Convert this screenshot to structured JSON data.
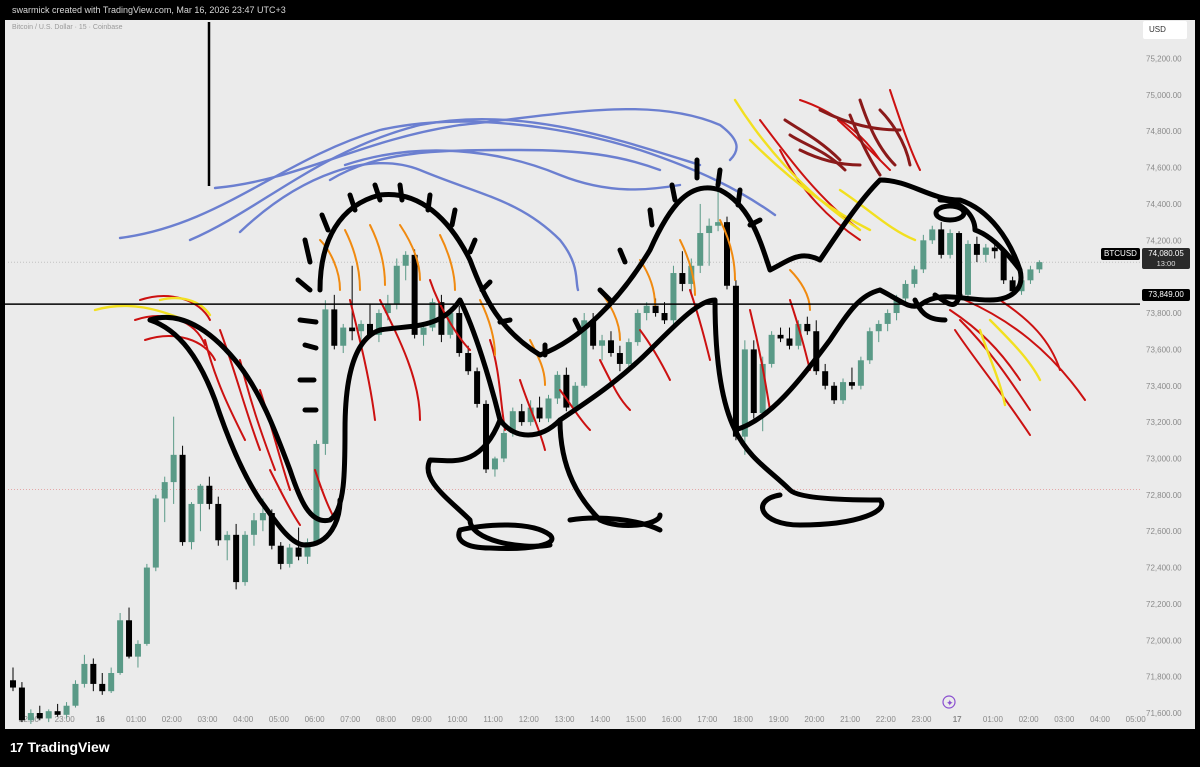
{
  "header": {
    "attribution": "swarmick created with TradingView.com, Mar 16, 2026 23:47 UTC+3"
  },
  "symbol": {
    "description": "Bitcoin / U.S. Dollar · 15 · Coinbase",
    "currency_button": "USD"
  },
  "price_labels": {
    "last_ticker": "BTCUSD",
    "last_price": "74,080.05",
    "countdown": "13:00",
    "horizontal_line_price": "73,849.00"
  },
  "branding": {
    "logo_mark": "17",
    "logo_text": "TradingView"
  },
  "colors": {
    "background": "#ebebeb",
    "up_candle": "#5a9a87",
    "down_candle": "#000000",
    "drawing_black": "#000000",
    "drawing_blue": "#6b7fd0",
    "drawing_red": "#cc1111",
    "drawing_darkred": "#8a1a1a",
    "drawing_orange": "#f08a10",
    "drawing_yellow": "#f2e020",
    "countdown_bg": "#2a2a2a"
  },
  "chart_data": {
    "type": "candlestick",
    "title": "Bitcoin / U.S. Dollar · 15 · Coinbase",
    "y_axis": {
      "ticks": [
        "75,200.00",
        "75,000.00",
        "74,800.00",
        "74,600.00",
        "74,400.00",
        "74,200.00",
        "73,800.00",
        "73,600.00",
        "73,400.00",
        "73,200.00",
        "73,000.00",
        "72,800.00",
        "72,600.00",
        "72,400.00",
        "72,200.00",
        "72,000.00",
        "71,800.00",
        "71,600.00"
      ],
      "range": [
        71500,
        75300
      ]
    },
    "x_axis": {
      "ticks": [
        "22:00",
        "23:00",
        "16",
        "01:00",
        "02:00",
        "03:00",
        "04:00",
        "05:00",
        "06:00",
        "07:00",
        "08:00",
        "09:00",
        "10:00",
        "11:00",
        "12:00",
        "13:00",
        "14:00",
        "15:00",
        "16:00",
        "17:00",
        "18:00",
        "19:00",
        "20:00",
        "21:00",
        "22:00",
        "23:00",
        "17",
        "01:00",
        "02:00",
        "03:00",
        "04:00",
        "05:00"
      ]
    },
    "candles": [
      {
        "o": 71780,
        "h": 71850,
        "l": 71720,
        "c": 71740
      },
      {
        "o": 71740,
        "h": 71770,
        "l": 71550,
        "c": 71560
      },
      {
        "o": 71560,
        "h": 71620,
        "l": 71540,
        "c": 71600
      },
      {
        "o": 71600,
        "h": 71640,
        "l": 71560,
        "c": 71570
      },
      {
        "o": 71570,
        "h": 71620,
        "l": 71550,
        "c": 71610
      },
      {
        "o": 71610,
        "h": 71650,
        "l": 71580,
        "c": 71590
      },
      {
        "o": 71590,
        "h": 71660,
        "l": 71570,
        "c": 71640
      },
      {
        "o": 71640,
        "h": 71780,
        "l": 71630,
        "c": 71760
      },
      {
        "o": 71760,
        "h": 71920,
        "l": 71740,
        "c": 71870
      },
      {
        "o": 71870,
        "h": 71900,
        "l": 71720,
        "c": 71760
      },
      {
        "o": 71760,
        "h": 71820,
        "l": 71700,
        "c": 71720
      },
      {
        "o": 71720,
        "h": 71850,
        "l": 71710,
        "c": 71820
      },
      {
        "o": 71820,
        "h": 72150,
        "l": 71810,
        "c": 72110
      },
      {
        "o": 72110,
        "h": 72180,
        "l": 71900,
        "c": 71910
      },
      {
        "o": 71910,
        "h": 72000,
        "l": 71850,
        "c": 71980
      },
      {
        "o": 71980,
        "h": 72420,
        "l": 71970,
        "c": 72400
      },
      {
        "o": 72400,
        "h": 72800,
        "l": 72380,
        "c": 72780
      },
      {
        "o": 72780,
        "h": 72900,
        "l": 72650,
        "c": 72870
      },
      {
        "o": 72870,
        "h": 73230,
        "l": 72750,
        "c": 73020
      },
      {
        "o": 73020,
        "h": 73070,
        "l": 72520,
        "c": 72540
      },
      {
        "o": 72540,
        "h": 72760,
        "l": 72500,
        "c": 72750
      },
      {
        "o": 72750,
        "h": 72860,
        "l": 72600,
        "c": 72850
      },
      {
        "o": 72850,
        "h": 72900,
        "l": 72720,
        "c": 72750
      },
      {
        "o": 72750,
        "h": 72790,
        "l": 72520,
        "c": 72550
      },
      {
        "o": 72550,
        "h": 72600,
        "l": 72440,
        "c": 72580
      },
      {
        "o": 72580,
        "h": 72640,
        "l": 72280,
        "c": 72320
      },
      {
        "o": 72320,
        "h": 72600,
        "l": 72300,
        "c": 72580
      },
      {
        "o": 72580,
        "h": 72700,
        "l": 72520,
        "c": 72660
      },
      {
        "o": 72660,
        "h": 72780,
        "l": 72600,
        "c": 72700
      },
      {
        "o": 72700,
        "h": 72720,
        "l": 72500,
        "c": 72520
      },
      {
        "o": 72520,
        "h": 72540,
        "l": 72390,
        "c": 72420
      },
      {
        "o": 72420,
        "h": 72530,
        "l": 72400,
        "c": 72510
      },
      {
        "o": 72510,
        "h": 72620,
        "l": 72440,
        "c": 72460
      },
      {
        "o": 72460,
        "h": 72560,
        "l": 72420,
        "c": 72540
      },
      {
        "o": 72540,
        "h": 73100,
        "l": 72530,
        "c": 73080
      },
      {
        "o": 73080,
        "h": 73870,
        "l": 73020,
        "c": 73820
      },
      {
        "o": 73820,
        "h": 73900,
        "l": 73600,
        "c": 73620
      },
      {
        "o": 73620,
        "h": 73740,
        "l": 73580,
        "c": 73720
      },
      {
        "o": 73720,
        "h": 74060,
        "l": 73650,
        "c": 73700
      },
      {
        "o": 73700,
        "h": 73760,
        "l": 73620,
        "c": 73740
      },
      {
        "o": 73740,
        "h": 73850,
        "l": 73660,
        "c": 73680
      },
      {
        "o": 73680,
        "h": 73820,
        "l": 73640,
        "c": 73800
      },
      {
        "o": 73800,
        "h": 73900,
        "l": 73760,
        "c": 73850
      },
      {
        "o": 73850,
        "h": 74100,
        "l": 73820,
        "c": 74060
      },
      {
        "o": 74060,
        "h": 74140,
        "l": 73980,
        "c": 74120
      },
      {
        "o": 74120,
        "h": 74150,
        "l": 73660,
        "c": 73680
      },
      {
        "o": 73680,
        "h": 73750,
        "l": 73620,
        "c": 73720
      },
      {
        "o": 73720,
        "h": 73880,
        "l": 73700,
        "c": 73860
      },
      {
        "o": 73860,
        "h": 73900,
        "l": 73640,
        "c": 73680
      },
      {
        "o": 73680,
        "h": 73830,
        "l": 73660,
        "c": 73800
      },
      {
        "o": 73800,
        "h": 73840,
        "l": 73560,
        "c": 73580
      },
      {
        "o": 73580,
        "h": 73620,
        "l": 73460,
        "c": 73480
      },
      {
        "o": 73480,
        "h": 73500,
        "l": 73280,
        "c": 73300
      },
      {
        "o": 73300,
        "h": 73320,
        "l": 72920,
        "c": 72940
      },
      {
        "o": 72940,
        "h": 73010,
        "l": 72900,
        "c": 73000
      },
      {
        "o": 73000,
        "h": 73160,
        "l": 72980,
        "c": 73140
      },
      {
        "o": 73140,
        "h": 73280,
        "l": 73120,
        "c": 73260
      },
      {
        "o": 73260,
        "h": 73300,
        "l": 73180,
        "c": 73200
      },
      {
        "o": 73200,
        "h": 73320,
        "l": 73180,
        "c": 73280
      },
      {
        "o": 73280,
        "h": 73340,
        "l": 73200,
        "c": 73220
      },
      {
        "o": 73220,
        "h": 73350,
        "l": 73200,
        "c": 73330
      },
      {
        "o": 73330,
        "h": 73480,
        "l": 73300,
        "c": 73460
      },
      {
        "o": 73460,
        "h": 73500,
        "l": 73260,
        "c": 73280
      },
      {
        "o": 73280,
        "h": 73420,
        "l": 73270,
        "c": 73400
      },
      {
        "o": 73400,
        "h": 73800,
        "l": 73390,
        "c": 73760
      },
      {
        "o": 73760,
        "h": 73800,
        "l": 73600,
        "c": 73620
      },
      {
        "o": 73620,
        "h": 73680,
        "l": 73540,
        "c": 73650
      },
      {
        "o": 73650,
        "h": 73700,
        "l": 73560,
        "c": 73580
      },
      {
        "o": 73580,
        "h": 73620,
        "l": 73480,
        "c": 73520
      },
      {
        "o": 73520,
        "h": 73660,
        "l": 73500,
        "c": 73640
      },
      {
        "o": 73640,
        "h": 73820,
        "l": 73620,
        "c": 73800
      },
      {
        "o": 73800,
        "h": 73860,
        "l": 73760,
        "c": 73840
      },
      {
        "o": 73840,
        "h": 73880,
        "l": 73780,
        "c": 73800
      },
      {
        "o": 73800,
        "h": 73860,
        "l": 73740,
        "c": 73760
      },
      {
        "o": 73760,
        "h": 74060,
        "l": 73740,
        "c": 74020
      },
      {
        "o": 74020,
        "h": 74140,
        "l": 73920,
        "c": 73960
      },
      {
        "o": 73960,
        "h": 74100,
        "l": 73900,
        "c": 74060
      },
      {
        "o": 74060,
        "h": 74400,
        "l": 74020,
        "c": 74240
      },
      {
        "o": 74240,
        "h": 74320,
        "l": 74060,
        "c": 74280
      },
      {
        "o": 74280,
        "h": 74560,
        "l": 74250,
        "c": 74300
      },
      {
        "o": 74300,
        "h": 74330,
        "l": 73930,
        "c": 73950
      },
      {
        "o": 73950,
        "h": 73980,
        "l": 73100,
        "c": 73120
      },
      {
        "o": 73120,
        "h": 73650,
        "l": 73020,
        "c": 73600
      },
      {
        "o": 73600,
        "h": 73650,
        "l": 73220,
        "c": 73250
      },
      {
        "o": 73250,
        "h": 73560,
        "l": 73150,
        "c": 73520
      },
      {
        "o": 73520,
        "h": 73700,
        "l": 73500,
        "c": 73680
      },
      {
        "o": 73680,
        "h": 73720,
        "l": 73640,
        "c": 73660
      },
      {
        "o": 73660,
        "h": 73720,
        "l": 73600,
        "c": 73620
      },
      {
        "o": 73620,
        "h": 73760,
        "l": 73600,
        "c": 73740
      },
      {
        "o": 73740,
        "h": 73780,
        "l": 73680,
        "c": 73700
      },
      {
        "o": 73700,
        "h": 73760,
        "l": 73460,
        "c": 73480
      },
      {
        "o": 73480,
        "h": 73520,
        "l": 73380,
        "c": 73400
      },
      {
        "o": 73400,
        "h": 73420,
        "l": 73300,
        "c": 73320
      },
      {
        "o": 73320,
        "h": 73440,
        "l": 73300,
        "c": 73420
      },
      {
        "o": 73420,
        "h": 73500,
        "l": 73380,
        "c": 73400
      },
      {
        "o": 73400,
        "h": 73560,
        "l": 73380,
        "c": 73540
      },
      {
        "o": 73540,
        "h": 73720,
        "l": 73520,
        "c": 73700
      },
      {
        "o": 73700,
        "h": 73760,
        "l": 73640,
        "c": 73740
      },
      {
        "o": 73740,
        "h": 73820,
        "l": 73700,
        "c": 73800
      },
      {
        "o": 73800,
        "h": 73900,
        "l": 73760,
        "c": 73880
      },
      {
        "o": 73880,
        "h": 73980,
        "l": 73840,
        "c": 73960
      },
      {
        "o": 73960,
        "h": 74060,
        "l": 73940,
        "c": 74040
      },
      {
        "o": 74040,
        "h": 74230,
        "l": 74020,
        "c": 74200
      },
      {
        "o": 74200,
        "h": 74280,
        "l": 74180,
        "c": 74260
      },
      {
        "o": 74260,
        "h": 74300,
        "l": 74100,
        "c": 74120
      },
      {
        "o": 74120,
        "h": 74260,
        "l": 74100,
        "c": 74240
      },
      {
        "o": 74240,
        "h": 74250,
        "l": 73880,
        "c": 73900
      },
      {
        "o": 73900,
        "h": 74200,
        "l": 73860,
        "c": 74180
      },
      {
        "o": 74180,
        "h": 74220,
        "l": 74080,
        "c": 74120
      },
      {
        "o": 74120,
        "h": 74180,
        "l": 74080,
        "c": 74160
      },
      {
        "o": 74160,
        "h": 74190,
        "l": 74100,
        "c": 74140
      },
      {
        "o": 74140,
        "h": 74160,
        "l": 73960,
        "c": 73980
      },
      {
        "o": 73980,
        "h": 74000,
        "l": 73900,
        "c": 73920
      },
      {
        "o": 73920,
        "h": 73990,
        "l": 73900,
        "c": 73980
      },
      {
        "o": 73980,
        "h": 74060,
        "l": 73960,
        "c": 74040
      },
      {
        "o": 74040,
        "h": 74090,
        "l": 74020,
        "c": 74080
      }
    ],
    "last_price": 74080.05,
    "horizontal_line": 73849.0,
    "grid": false
  }
}
